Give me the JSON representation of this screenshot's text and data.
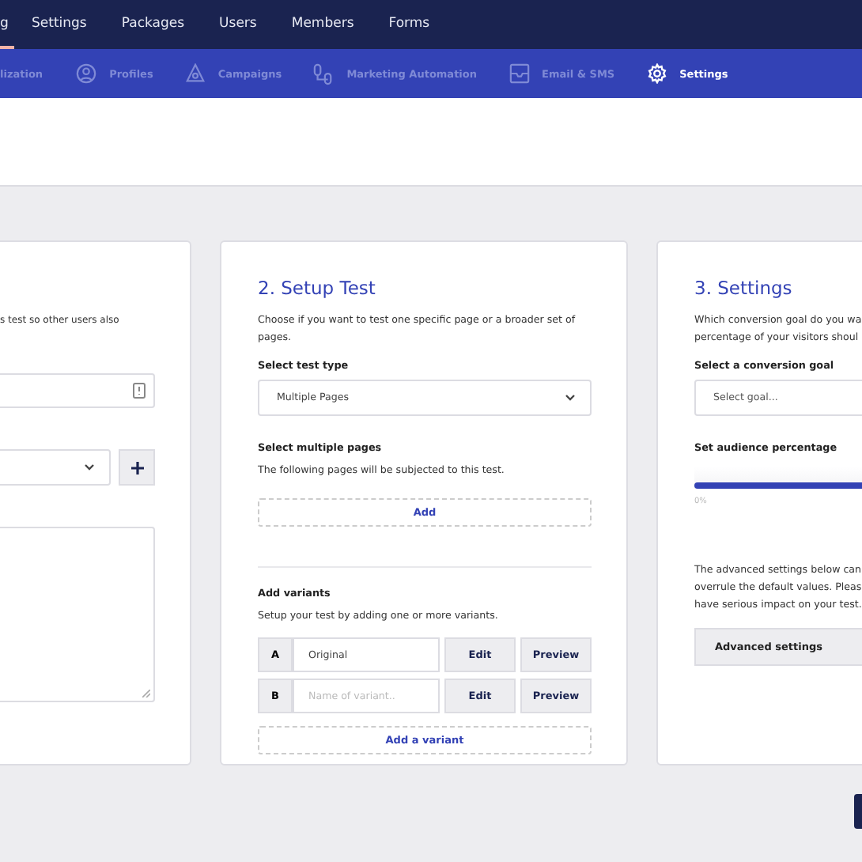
{
  "top_nav": [
    {
      "label": "g",
      "selected": true
    },
    {
      "label": "Settings",
      "selected": false
    },
    {
      "label": "Packages",
      "selected": false
    },
    {
      "label": "Users",
      "selected": false
    },
    {
      "label": "Members",
      "selected": false
    },
    {
      "label": "Forms",
      "selected": false
    }
  ],
  "sub_nav": [
    {
      "label": "lization",
      "selected": false
    },
    {
      "label": "Profiles",
      "selected": false
    },
    {
      "label": "Campaigns",
      "selected": false
    },
    {
      "label": "Marketing Automation",
      "selected": false
    },
    {
      "label": "Email & SMS",
      "selected": false
    },
    {
      "label": "Settings",
      "selected": true
    }
  ],
  "card_1": {
    "description": "s test so other users also"
  },
  "card_2": {
    "title": "2. Setup Test",
    "description": "Choose if you want to test one specific page or a broader set of pages.",
    "test_type_label": "Select test type",
    "test_type_value": "Multiple Pages",
    "pages_label": "Select multiple pages",
    "pages_description": "The following pages will be subjected to this test.",
    "add_button": "Add",
    "variants_label": "Add variants",
    "variants_description": "Setup your test by adding one or more variants.",
    "variants": [
      {
        "letter": "A",
        "value": "Original",
        "edit": "Edit",
        "preview": "Preview"
      },
      {
        "letter": "B",
        "placeholder": "Name of variant..",
        "edit": "Edit",
        "preview": "Preview"
      }
    ],
    "add_variant_button": "Add a variant"
  },
  "card_3": {
    "title": "3. Settings",
    "description_lines": [
      "Which conversion goal do you wa",
      "percentage of your visitors shoul"
    ],
    "goal_label": "Select a conversion goal",
    "goal_placeholder": "Select goal...",
    "audience_label": "Set audience percentage",
    "audience_slider": {
      "level": 1,
      "reading": "0%"
    },
    "advanced_lines": [
      "The advanced settings below can",
      "overrule the default values. Pleas",
      "have serious impact on your test."
    ],
    "advanced_button": "Advanced settings"
  }
}
